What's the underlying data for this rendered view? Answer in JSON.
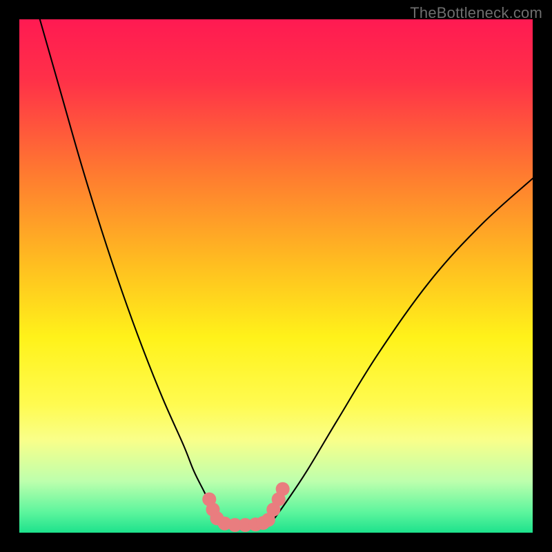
{
  "watermark": "TheBottleneck.com",
  "colors": {
    "black": "#000000",
    "curve": "#000000",
    "marker": "#e97d7f",
    "gradient_stops": [
      {
        "offset": 0,
        "color": "#ff1a52"
      },
      {
        "offset": 0.12,
        "color": "#ff3148"
      },
      {
        "offset": 0.3,
        "color": "#ff7a30"
      },
      {
        "offset": 0.48,
        "color": "#ffbf20"
      },
      {
        "offset": 0.62,
        "color": "#fff21a"
      },
      {
        "offset": 0.75,
        "color": "#fffb50"
      },
      {
        "offset": 0.82,
        "color": "#f9ff8a"
      },
      {
        "offset": 0.9,
        "color": "#bdffad"
      },
      {
        "offset": 0.96,
        "color": "#5df59d"
      },
      {
        "offset": 1.0,
        "color": "#1de28c"
      }
    ]
  },
  "chart_data": {
    "type": "line",
    "title": "",
    "xlabel": "",
    "ylabel": "",
    "xlim": [
      0,
      100
    ],
    "ylim": [
      0,
      100
    ],
    "series": [
      {
        "name": "left-curve",
        "x": [
          4,
          8,
          12,
          16,
          20,
          24,
          28,
          32,
          34,
          36,
          38,
          38.5
        ],
        "y": [
          100,
          86,
          72,
          59,
          47,
          36,
          26,
          17,
          12,
          8,
          4,
          2.5
        ]
      },
      {
        "name": "valley-floor",
        "x": [
          38.5,
          40,
          42,
          44,
          46,
          48,
          49.5
        ],
        "y": [
          2.5,
          1.5,
          1.2,
          1.2,
          1.3,
          1.6,
          2.5
        ]
      },
      {
        "name": "right-curve",
        "x": [
          49.5,
          52,
          56,
          62,
          70,
          80,
          90,
          100
        ],
        "y": [
          2.5,
          6,
          12,
          22,
          35,
          49,
          60,
          69
        ]
      }
    ],
    "markers": {
      "name": "bottleneck-range",
      "color": "#e97d7f",
      "points": [
        {
          "x": 37,
          "y": 6.5
        },
        {
          "x": 37.7,
          "y": 4.5
        },
        {
          "x": 38.5,
          "y": 2.8
        },
        {
          "x": 40,
          "y": 1.8
        },
        {
          "x": 42,
          "y": 1.5
        },
        {
          "x": 44,
          "y": 1.5
        },
        {
          "x": 46,
          "y": 1.6
        },
        {
          "x": 47.5,
          "y": 1.9
        },
        {
          "x": 48.5,
          "y": 2.5
        },
        {
          "x": 49.5,
          "y": 4.5
        },
        {
          "x": 50.5,
          "y": 6.5
        },
        {
          "x": 51.3,
          "y": 8.5
        }
      ]
    }
  }
}
